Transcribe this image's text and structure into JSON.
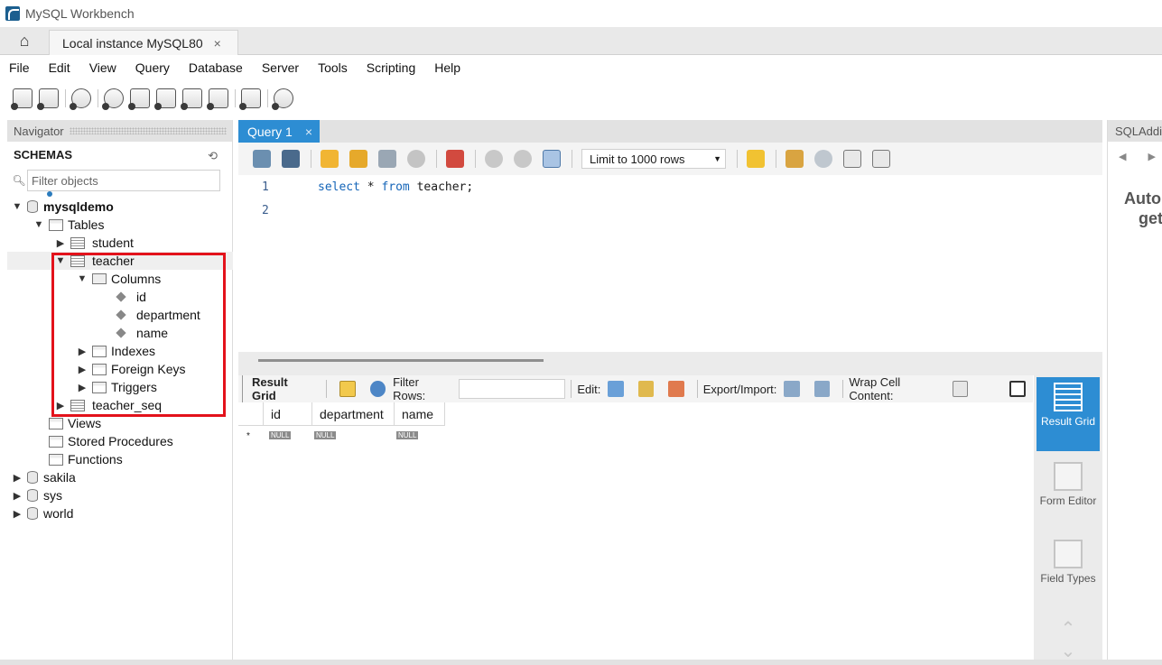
{
  "window": {
    "title": "MySQL Workbench"
  },
  "tabs": {
    "connection_tab": "Local instance MySQL80",
    "close_glyph": "×"
  },
  "menu": [
    "File",
    "Edit",
    "View",
    "Query",
    "Database",
    "Server",
    "Tools",
    "Scripting",
    "Help"
  ],
  "navigator": {
    "header": "Navigator",
    "schemas_label": "SCHEMAS",
    "filter_placeholder": "Filter objects",
    "tree": {
      "db_mysqldemo": "mysqldemo",
      "tables": "Tables",
      "student": "student",
      "teacher": "teacher",
      "columns": "Columns",
      "col_id": "id",
      "col_department": "department",
      "col_name": "name",
      "indexes": "Indexes",
      "foreign_keys": "Foreign Keys",
      "triggers": "Triggers",
      "teacher_seq": "teacher_seq",
      "views": "Views",
      "stored_procedures": "Stored Procedures",
      "functions": "Functions",
      "db_sakila": "sakila",
      "db_sys": "sys",
      "db_world": "world"
    }
  },
  "query_tab": {
    "label": "Query 1",
    "close_glyph": "×"
  },
  "sql_toolbar": {
    "limit_label": "Limit to 1000 rows"
  },
  "editor": {
    "line1_no": "1",
    "line2_no": "2",
    "kw_select": "select",
    "star": " * ",
    "kw_from": "from",
    "rest": " teacher;"
  },
  "result_toolbar": {
    "result_grid": "Result Grid",
    "filter_rows": "Filter Rows:",
    "edit": "Edit:",
    "export_import": "Export/Import:",
    "wrap": "Wrap Cell Content:"
  },
  "grid": {
    "columns": [
      "id",
      "department",
      "name"
    ],
    "null_label": "NULL",
    "new_row_marker": "*"
  },
  "side_panel": {
    "result_grid": "Result Grid",
    "form_editor": "Form Editor",
    "field_types": "Field Types"
  },
  "sql_additions": {
    "header": "SQLAdditions",
    "text_line1": "Auto",
    "text_line2": "get"
  },
  "colors": {
    "accent": "#2d8dd3",
    "highlight": "#e3121b",
    "keyword": "#1565b8"
  }
}
